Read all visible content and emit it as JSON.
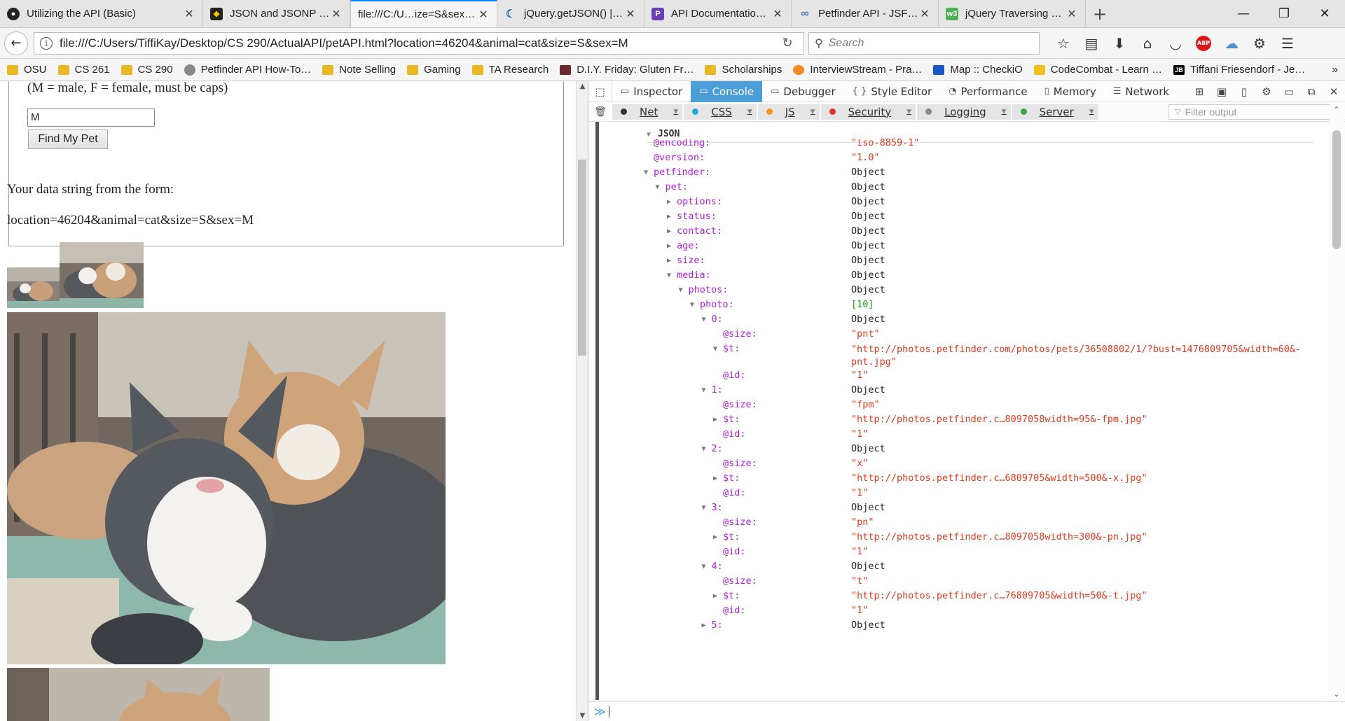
{
  "browser": {
    "tabs": [
      {
        "label": "Utilizing the API (Basic)",
        "icon": "github-icon"
      },
      {
        "label": "JSON and JSONP in j…",
        "icon": "site-icon"
      },
      {
        "label": "file:///C:/U…ize=S&sex=M",
        "icon": "none"
      },
      {
        "label": "jQuery.getJSON() | j…",
        "icon": "jquery-icon"
      },
      {
        "label": "API Documentation -…",
        "icon": "pf-icon"
      },
      {
        "label": "Petfinder API - JSFid…",
        "icon": "jsfiddle-icon"
      },
      {
        "label": "jQuery Traversing M…",
        "icon": "w3-icon"
      }
    ],
    "url": "file:///C:/Users/TiffiKay/Desktop/CS 290/ActualAPI/petAPI.html?location=46204&animal=cat&size=S&sex=M",
    "search_placeholder": "Search",
    "abp_label": "ABP",
    "bookmarks": [
      {
        "label": "OSU",
        "icon": "folder"
      },
      {
        "label": "CS 261",
        "icon": "folder"
      },
      {
        "label": "CS 290",
        "icon": "folder"
      },
      {
        "label": "Petfinder API How-To…",
        "icon": "globe"
      },
      {
        "label": "Note Selling",
        "icon": "folder"
      },
      {
        "label": "Gaming",
        "icon": "folder"
      },
      {
        "label": "TA Research",
        "icon": "folder"
      },
      {
        "label": "D.I.Y. Friday: Gluten Fr…",
        "icon": "site"
      },
      {
        "label": "Scholarships",
        "icon": "folder"
      },
      {
        "label": "InterviewStream - Pra…",
        "icon": "orange"
      },
      {
        "label": "Map :: CheckiO",
        "icon": "blue"
      },
      {
        "label": "CodeCombat - Learn …",
        "icon": "cc"
      },
      {
        "label": "Tiffani Friesendorf - Je…",
        "icon": "jb"
      }
    ],
    "jb_badge": "JB"
  },
  "page": {
    "hint": "(M = male, F = female, must be caps)",
    "sex_value": "M",
    "find_button": "Find My Pet",
    "data_heading": "Your data string from the form:",
    "data_string": "location=46204&animal=cat&size=S&sex=M"
  },
  "devtools": {
    "tabs": [
      {
        "label": "Inspector",
        "icon": "▭"
      },
      {
        "label": "Console",
        "icon": "▭"
      },
      {
        "label": "Debugger",
        "icon": "▭"
      },
      {
        "label": "Style Editor",
        "icon": "{ }"
      },
      {
        "label": "Performance",
        "icon": "◔"
      },
      {
        "label": "Memory",
        "icon": "▯"
      },
      {
        "label": "Network",
        "icon": "☰"
      }
    ],
    "active_tab": "Console",
    "filters": [
      {
        "label": "Net",
        "color": "#333333"
      },
      {
        "label": "CSS",
        "color": "#1ea7e0"
      },
      {
        "label": "JS",
        "color": "#f5931e"
      },
      {
        "label": "Security",
        "color": "#e8312f"
      },
      {
        "label": "Logging",
        "color": "#888888"
      },
      {
        "label": "Server",
        "color": "#3aa650"
      }
    ],
    "filter_placeholder": "Filter output",
    "json_title": "JSON",
    "tree": [
      {
        "key": "@encoding:",
        "val": "\"iso-8859-1\"",
        "depth": 0,
        "tw": "",
        "str": true
      },
      {
        "key": "@version:",
        "val": "\"1.0\"",
        "depth": 0,
        "tw": "",
        "str": true
      },
      {
        "key": "petfinder:",
        "val": "Object",
        "depth": 0,
        "tw": "open"
      },
      {
        "key": "pet:",
        "val": "Object",
        "depth": 1,
        "tw": "open"
      },
      {
        "key": "options:",
        "val": "Object",
        "depth": 2,
        "tw": "closed"
      },
      {
        "key": "status:",
        "val": "Object",
        "depth": 2,
        "tw": "closed"
      },
      {
        "key": "contact:",
        "val": "Object",
        "depth": 2,
        "tw": "closed"
      },
      {
        "key": "age:",
        "val": "Object",
        "depth": 2,
        "tw": "closed"
      },
      {
        "key": "size:",
        "val": "Object",
        "depth": 2,
        "tw": "closed"
      },
      {
        "key": "media:",
        "val": "Object",
        "depth": 2,
        "tw": "open"
      },
      {
        "key": "photos:",
        "val": "Object",
        "depth": 3,
        "tw": "open"
      },
      {
        "key": "photo:",
        "val": "[10]",
        "depth": 4,
        "tw": "open",
        "arr": true
      },
      {
        "key": "0:",
        "val": "Object",
        "depth": 5,
        "tw": "open"
      },
      {
        "key": "@size:",
        "val": "\"pnt\"",
        "depth": 6,
        "tw": "",
        "str": true
      },
      {
        "key": "$t:",
        "val": "\"http://photos.petfinder.com/photos/pets/36508802/1/?bust=1476809705&width=60&-pnt.jpg\"",
        "depth": 6,
        "tw": "open",
        "str": true,
        "wrap": true
      },
      {
        "key": "@id:",
        "val": "\"1\"",
        "depth": 6,
        "tw": "",
        "str": true
      },
      {
        "key": "1:",
        "val": "Object",
        "depth": 5,
        "tw": "open"
      },
      {
        "key": "@size:",
        "val": "\"fpm\"",
        "depth": 6,
        "tw": "",
        "str": true
      },
      {
        "key": "$t:",
        "val": "\"http://photos.petfinder.c…8097058width=95&-fpm.jpg\"",
        "depth": 6,
        "tw": "closed",
        "str": true
      },
      {
        "key": "@id:",
        "val": "\"1\"",
        "depth": 6,
        "tw": "",
        "str": true
      },
      {
        "key": "2:",
        "val": "Object",
        "depth": 5,
        "tw": "open"
      },
      {
        "key": "@size:",
        "val": "\"x\"",
        "depth": 6,
        "tw": "",
        "str": true
      },
      {
        "key": "$t:",
        "val": "\"http://photos.petfinder.c…6809705&width=500&-x.jpg\"",
        "depth": 6,
        "tw": "closed",
        "str": true
      },
      {
        "key": "@id:",
        "val": "\"1\"",
        "depth": 6,
        "tw": "",
        "str": true
      },
      {
        "key": "3:",
        "val": "Object",
        "depth": 5,
        "tw": "open"
      },
      {
        "key": "@size:",
        "val": "\"pn\"",
        "depth": 6,
        "tw": "",
        "str": true
      },
      {
        "key": "$t:",
        "val": "\"http://photos.petfinder.c…8097058width=300&-pn.jpg\"",
        "depth": 6,
        "tw": "closed",
        "str": true
      },
      {
        "key": "@id:",
        "val": "\"1\"",
        "depth": 6,
        "tw": "",
        "str": true
      },
      {
        "key": "4:",
        "val": "Object",
        "depth": 5,
        "tw": "open"
      },
      {
        "key": "@size:",
        "val": "\"t\"",
        "depth": 6,
        "tw": "",
        "str": true
      },
      {
        "key": "$t:",
        "val": "\"http://photos.petfinder.c…76809705&width=50&-t.jpg\"",
        "depth": 6,
        "tw": "closed",
        "str": true
      },
      {
        "key": "@id:",
        "val": "\"1\"",
        "depth": 6,
        "tw": "",
        "str": true
      },
      {
        "key": "5:",
        "val": "Object",
        "depth": 5,
        "tw": "closed"
      }
    ]
  }
}
